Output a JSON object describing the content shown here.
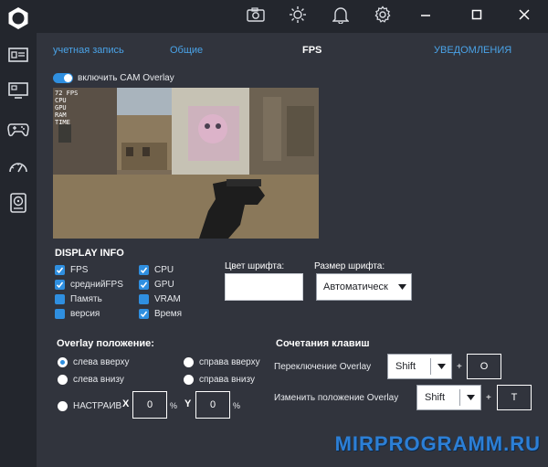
{
  "sidebar": {
    "items": [
      {
        "icon": "system-info-icon"
      },
      {
        "icon": "monitor-icon"
      },
      {
        "icon": "gamepad-icon"
      },
      {
        "icon": "speedometer-icon"
      },
      {
        "icon": "hard-drive-icon"
      }
    ]
  },
  "topbar": {
    "icons": [
      "camera-icon",
      "brightness-icon",
      "bell-icon",
      "gear-icon"
    ],
    "window_controls": [
      "minimize-icon",
      "maximize-icon",
      "close-icon"
    ]
  },
  "tabs": [
    {
      "label": "учетная запись"
    },
    {
      "label": "Общие"
    },
    {
      "label": "FPS"
    },
    {
      "label": "УВЕДОМЛЕНИЯ"
    }
  ],
  "overlay_toggle": {
    "label": "включить CAM Overlay",
    "on": true
  },
  "preview": {
    "fps_text": "72 FPS\nCPU\nGPU\nRAM\nTIME"
  },
  "display_info": {
    "title": "DISPLAY INFO",
    "left_items": [
      {
        "label": "FPS",
        "checked": true
      },
      {
        "label": "среднийFPS",
        "checked": true
      },
      {
        "label": "Память",
        "checked": false
      },
      {
        "label": "версия",
        "checked": false
      }
    ],
    "right_items": [
      {
        "label": "CPU",
        "checked": true
      },
      {
        "label": "GPU",
        "checked": true
      },
      {
        "label": "VRAM",
        "checked": false
      },
      {
        "label": "Время",
        "checked": true
      }
    ]
  },
  "font_color": {
    "label": "Цвет шрифта:",
    "value": "#ffffff"
  },
  "font_size": {
    "label": "Размер шрифта:",
    "value": "Автоматическ"
  },
  "overlay_position": {
    "title": "Overlay положение:",
    "options": [
      {
        "label": "слева вверху",
        "selected": true
      },
      {
        "label": "справа вверху",
        "selected": false
      },
      {
        "label": "слева внизу",
        "selected": false
      },
      {
        "label": "справа внизу",
        "selected": false
      },
      {
        "label": "НАСТРАИВ",
        "selected": false
      }
    ],
    "x_label": "X",
    "y_label": "Y",
    "x_value": "0",
    "y_value": "0",
    "unit": "%"
  },
  "hotkeys": {
    "title": "Сочетания клавиш",
    "rows": [
      {
        "label": "Переключение Overlay",
        "modifier": "Shift",
        "key": "O"
      },
      {
        "label": "Изменить положение Overlay",
        "modifier": "Shift",
        "key": "T"
      }
    ],
    "plus": "+"
  },
  "watermark": "MIRPROGRAMM.RU",
  "colors": {
    "accent": "#2f8fe0",
    "background": "#31343d",
    "sidebar": "#23262d",
    "tab_link": "#4aa3e8"
  }
}
